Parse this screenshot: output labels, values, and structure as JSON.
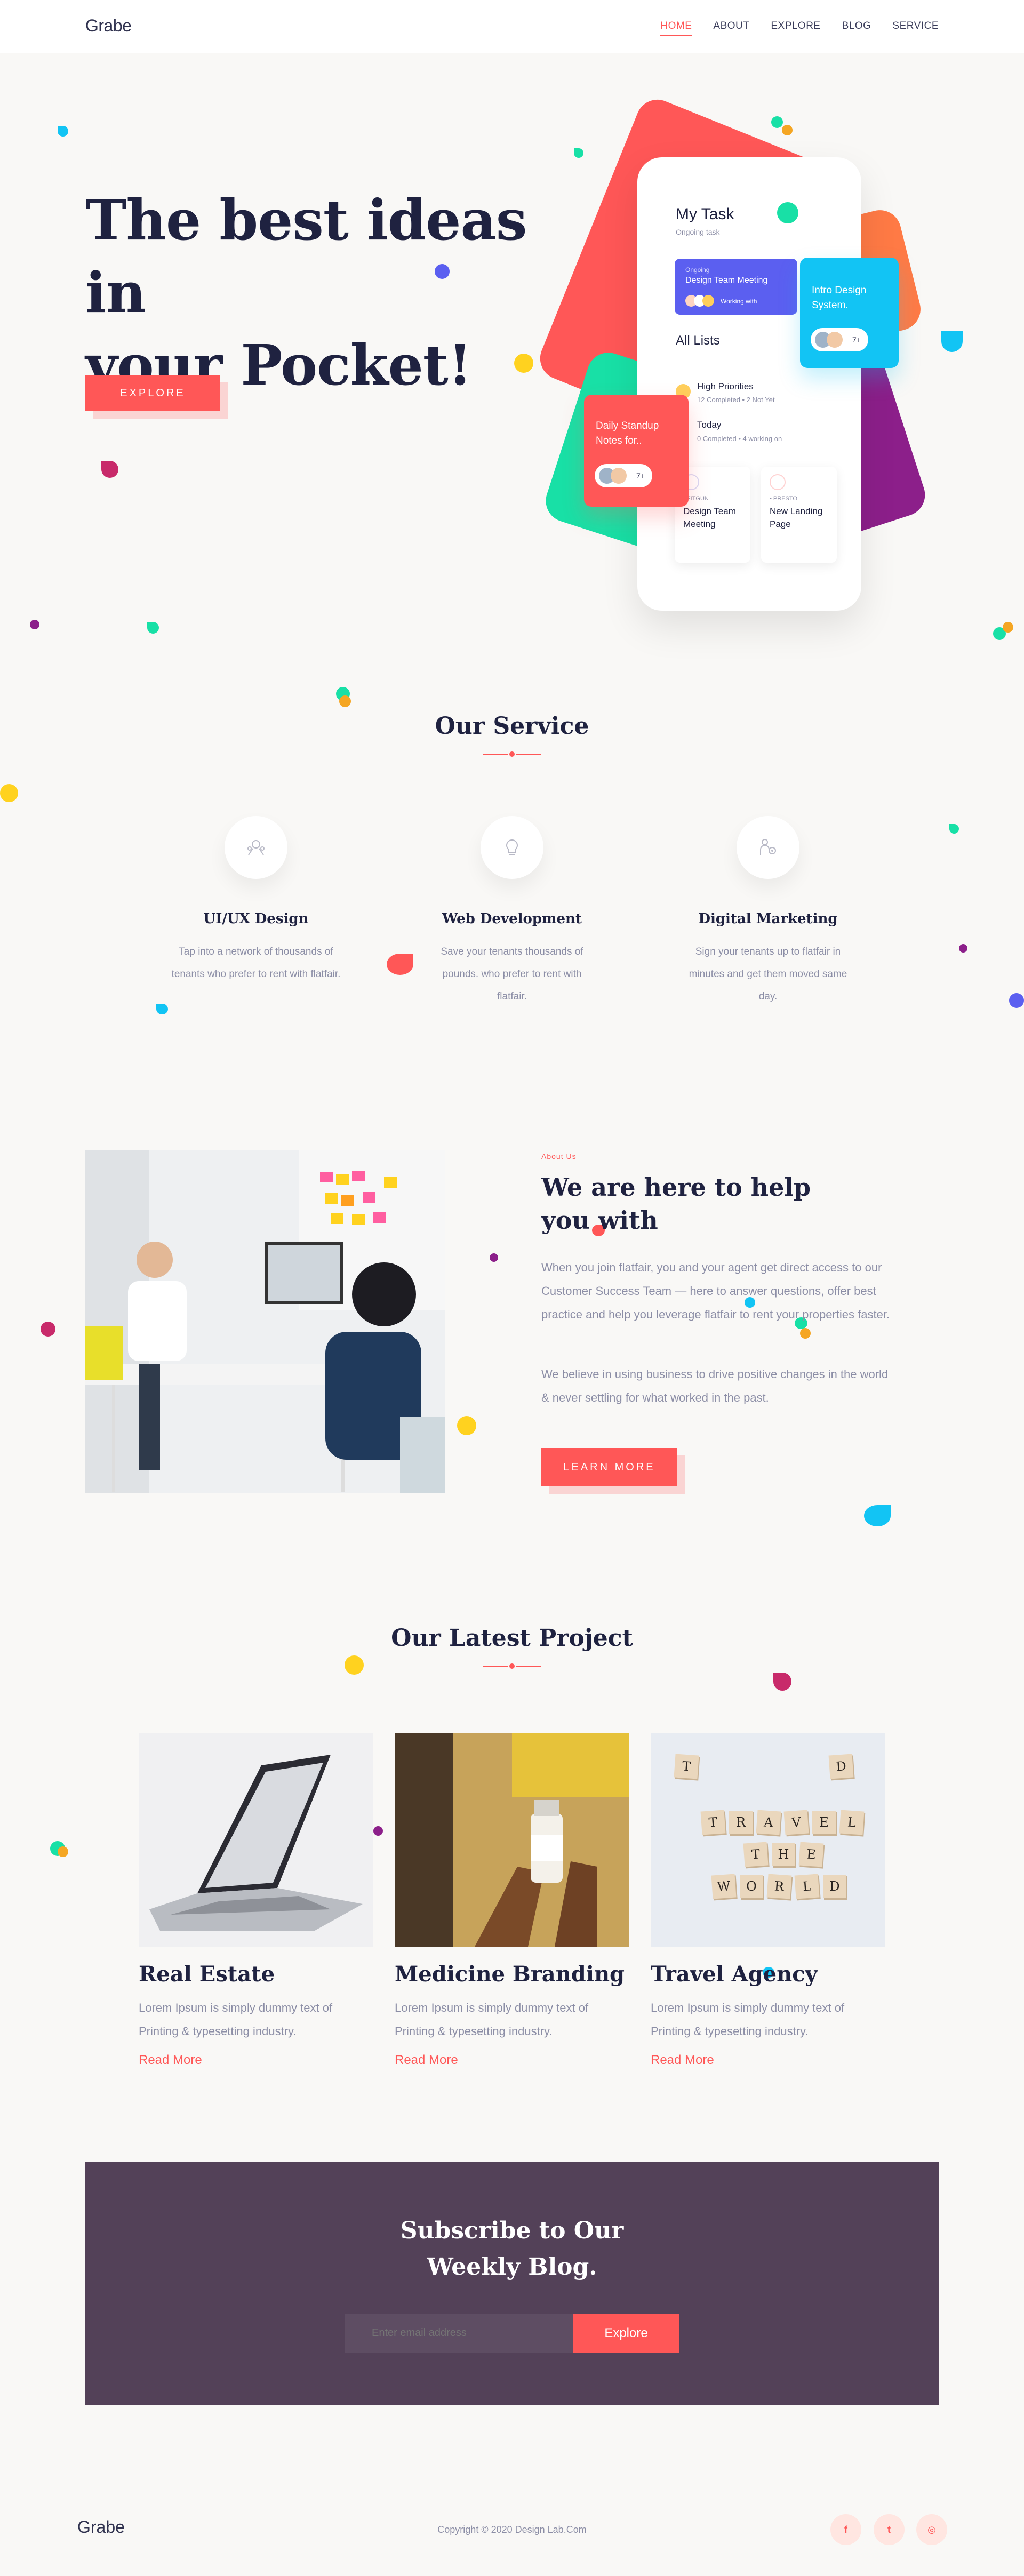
{
  "nav": {
    "logo": "Grabe",
    "items": [
      {
        "label": "HOME",
        "active": true
      },
      {
        "label": "ABOUT"
      },
      {
        "label": "EXPLORE"
      },
      {
        "label": "BLOG"
      },
      {
        "label": "SERVICE"
      }
    ]
  },
  "hero": {
    "title_line1": "The best ideas in",
    "title_line2": "your Pocket!",
    "button": "EXPLORE"
  },
  "app": {
    "title": "My Task",
    "subtitle": "Ongoing task",
    "card_kicker": "Ongoing",
    "card_title": "Design Team Meeting",
    "card_foot": "Working with",
    "all_lists": "All Lists",
    "section1": "High Priorities",
    "section1_meta": "12 Completed  •  2 Not Yet",
    "section2": "Today",
    "section2_meta": "0 Completed  •  4 working on",
    "mini1_tag": "• FITGUN",
    "mini1_name": "Design Team Meeting",
    "mini2_tag": "• PRESTO",
    "mini2_name": "New Landing Page",
    "float_cyan": "Intro Design System.",
    "float_red": "Daily Standup Notes for..",
    "badge": "7+"
  },
  "service": {
    "title": "Our Service",
    "items": [
      {
        "name": "UI/UX Design",
        "desc": "Tap into a network of thousands of tenants who prefer to rent with flatfair."
      },
      {
        "name": "Web Development",
        "desc": "Save your tenants thousands of pounds. who prefer to rent with flatfair."
      },
      {
        "name": "Digital Marketing",
        "desc": "Sign your tenants up to flatfair in minutes and get them moved same day."
      }
    ]
  },
  "about": {
    "kicker": "About Us",
    "title": "We are here to help you with",
    "p1": "When you join flatfair, you and your agent get direct access to our Customer Success Team — here to answer questions, offer best practice and help you leverage flatfair to rent your properties faster.",
    "p2": "We believe in using business to drive positive changes in the world & never settling for what worked in the past.",
    "button": "LEARN MORE"
  },
  "projects": {
    "title": "Our Latest Project",
    "items": [
      {
        "name": "Real Estate",
        "desc": "Lorem Ipsum is simply dummy text of Printing & typesetting industry.",
        "link": "Read More"
      },
      {
        "name": "Medicine Branding",
        "desc": "Lorem Ipsum is simply dummy text of Printing & typesetting industry.",
        "link": "Read More"
      },
      {
        "name": "Travel Agency",
        "desc": "Lorem Ipsum is simply dummy text of Printing & typesetting industry.",
        "link": "Read More"
      }
    ],
    "tiles": [
      "T",
      "R",
      "A",
      "V",
      "E",
      "L",
      "T",
      "H",
      "E",
      "W",
      "O",
      "R",
      "L",
      "D",
      "T",
      "D"
    ]
  },
  "subscribe": {
    "title_line1": "Subscribe to Our",
    "title_line2": "Weekly Blog.",
    "placeholder": "Enter email address",
    "button": "Explore"
  },
  "footer": {
    "logo": "Grabe",
    "copyright": "Copyright © 2020 Design Lab.Com",
    "social": [
      {
        "icon": "facebook-icon",
        "glyph": "f"
      },
      {
        "icon": "twitter-icon",
        "glyph": "t"
      },
      {
        "icon": "instagram-icon",
        "glyph": "◎"
      }
    ]
  },
  "colors": {
    "accent": "#ff5757",
    "dark": "#1f2240",
    "muted": "#8c8ea6",
    "subscribe_bg": "#534158"
  }
}
